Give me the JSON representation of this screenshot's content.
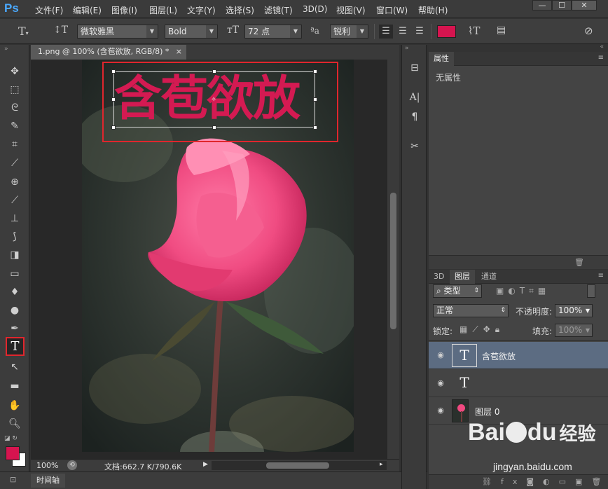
{
  "app": {
    "logo": "Ps"
  },
  "menu": [
    "文件(F)",
    "编辑(E)",
    "图像(I)",
    "图层(L)",
    "文字(Y)",
    "选择(S)",
    "滤镜(T)",
    "3D(D)",
    "视图(V)",
    "窗口(W)",
    "帮助(H)"
  ],
  "window_controls": {
    "minimize": "—",
    "maximize": "☐",
    "close": "✕"
  },
  "options": {
    "font_family": "微软雅黑",
    "font_style": "Bold",
    "font_size": "72 点",
    "aa_label": "ªa",
    "antialias": "锐利",
    "text_color": "#d6144f"
  },
  "document": {
    "tab_title": "1.png @ 100% (含苞欲放, RGB/8) *",
    "tab_close": "×",
    "canvas_text": "含苞欲放",
    "text_color": "#d41a52",
    "zoom": "100%",
    "doc_size": "文档:662.7 K/790.6K"
  },
  "timeline": {
    "label": "时间轴"
  },
  "properties": {
    "tab": "属性",
    "empty_text": "无属性"
  },
  "layers_panel": {
    "tabs": [
      "3D",
      "图层",
      "通道"
    ],
    "active_tab": 1,
    "filter_kind": "类型",
    "blend_mode": "正常",
    "opacity_label": "不透明度:",
    "opacity_value": "100%",
    "lock_label": "锁定:",
    "fill_label": "填充:",
    "fill_value": "100%",
    "layers": [
      {
        "name": "含苞欲放",
        "kind": "text",
        "selected": true
      },
      {
        "name": "",
        "kind": "text",
        "selected": false
      },
      {
        "name": "图层 0",
        "kind": "image",
        "selected": false
      }
    ]
  },
  "watermark": {
    "brand": "Bai",
    "brand2": "du",
    "sub": "经验",
    "url": "jingyan.baidu.com"
  },
  "colors": {
    "highlight": "#e0262d",
    "foreground": "#d6144f",
    "background": "#ffffff"
  }
}
